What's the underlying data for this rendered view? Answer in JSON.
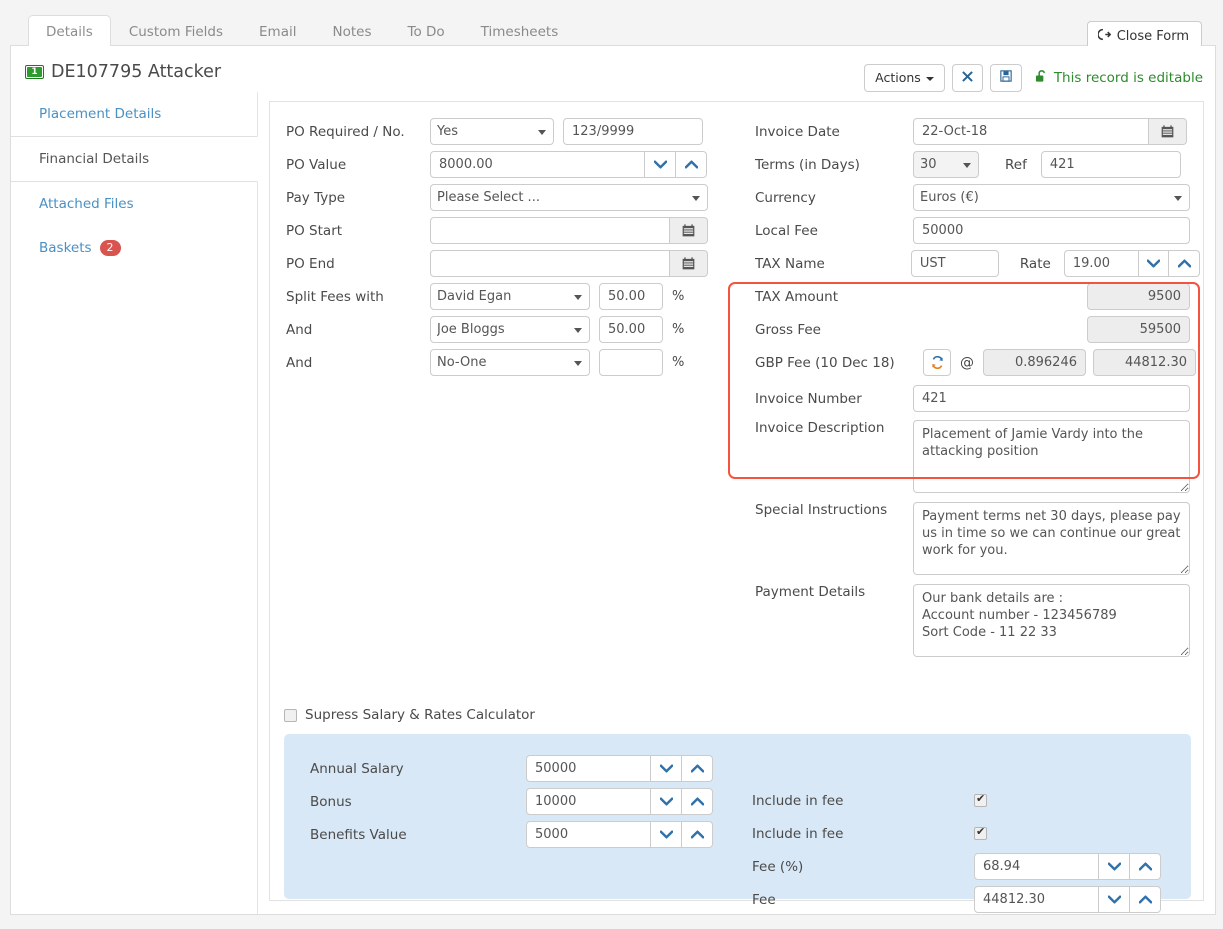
{
  "tabs": [
    {
      "label": "Details",
      "active": true
    },
    {
      "label": "Custom Fields",
      "active": false
    },
    {
      "label": "Email",
      "active": false
    },
    {
      "label": "Notes",
      "active": false
    },
    {
      "label": "To Do",
      "active": false
    },
    {
      "label": "Timesheets",
      "active": false
    }
  ],
  "header": {
    "close_form_label": "Close Form",
    "record_title": "DE107795 Attacker",
    "actions_label": "Actions",
    "delete_label": "✖",
    "save_label": "💾",
    "editable_status": "This record is editable"
  },
  "sidebar": {
    "items": [
      {
        "label": "Placement Details",
        "active": false,
        "badge": ""
      },
      {
        "label": "Financial Details",
        "active": true,
        "badge": ""
      },
      {
        "label": "Attached Files",
        "active": false,
        "badge": ""
      },
      {
        "label": "Baskets",
        "active": false,
        "badge": "2"
      }
    ]
  },
  "left_form": {
    "po_required_label": "PO Required / No.",
    "po_required_value": "Yes",
    "po_number_value": "123/9999",
    "po_value_label": "PO Value",
    "po_value": "8000.00",
    "pay_type_label": "Pay Type",
    "pay_type_value": "Please Select ...",
    "po_start_label": "PO Start",
    "po_start_value": "",
    "po_end_label": "PO End",
    "po_end_value": "",
    "split_fees_label": "Split Fees with",
    "split_1_name": "David Egan",
    "split_1_pct": "50.00",
    "and_label_1": "And",
    "split_2_name": "Joe Bloggs",
    "split_2_pct": "50.00",
    "and_label_2": "And",
    "split_3_name": "No-One",
    "split_3_pct": "",
    "percent_symbol": "%"
  },
  "right_form": {
    "invoice_date_label": "Invoice Date",
    "invoice_date_value": "22-Oct-18",
    "terms_label": "Terms (in Days)",
    "terms_value": "30",
    "ref_label": "Ref",
    "ref_value": "421",
    "currency_label": "Currency",
    "currency_value": "Euros (€)",
    "local_fee_label": "Local Fee",
    "local_fee_value": "50000",
    "tax_name_label": "TAX Name",
    "tax_name_value": "UST",
    "rate_label": "Rate",
    "rate_value": "19.00",
    "tax_amount_label": "TAX Amount",
    "tax_amount_value": "9500",
    "gross_fee_label": "Gross Fee",
    "gross_fee_value": "59500",
    "gbp_fee_label": "GBP Fee (10 Dec 18)",
    "at_symbol": "@",
    "exchange_rate_value": "0.896246",
    "gbp_fee_value": "44812.30",
    "invoice_number_label": "Invoice Number",
    "invoice_number_value": "421",
    "invoice_description_label": "Invoice Description",
    "invoice_description_value": "Placement of Jamie Vardy into the attacking position",
    "special_instructions_label": "Special Instructions",
    "special_instructions_value": "Payment terms net 30 days, please pay us in time so we can continue our great work for you.",
    "payment_details_label": "Payment Details",
    "payment_details_value": "Our bank details are :\nAccount number - 123456789\nSort Code - 11 22 33"
  },
  "calculator": {
    "supress_label": "Supress Salary & Rates Calculator",
    "supress_checked": false,
    "annual_salary_label": "Annual Salary",
    "annual_salary_value": "50000",
    "bonus_label": "Bonus",
    "bonus_value": "10000",
    "benefits_label": "Benefits Value",
    "benefits_value": "5000",
    "include_fee_label_1": "Include in fee",
    "include_fee_checked_1": true,
    "include_fee_label_2": "Include in fee",
    "include_fee_checked_2": true,
    "fee_pct_label": "Fee (%)",
    "fee_pct_value": "68.94",
    "fee_label": "Fee",
    "fee_value": "44812.30"
  },
  "colors": {
    "highlight_border": "#f4533f",
    "link_blue": "#4a90c4",
    "badge_red": "#d9534f",
    "status_green": "#2e8b2e",
    "calc_panel_bg": "#d9e8f6"
  }
}
